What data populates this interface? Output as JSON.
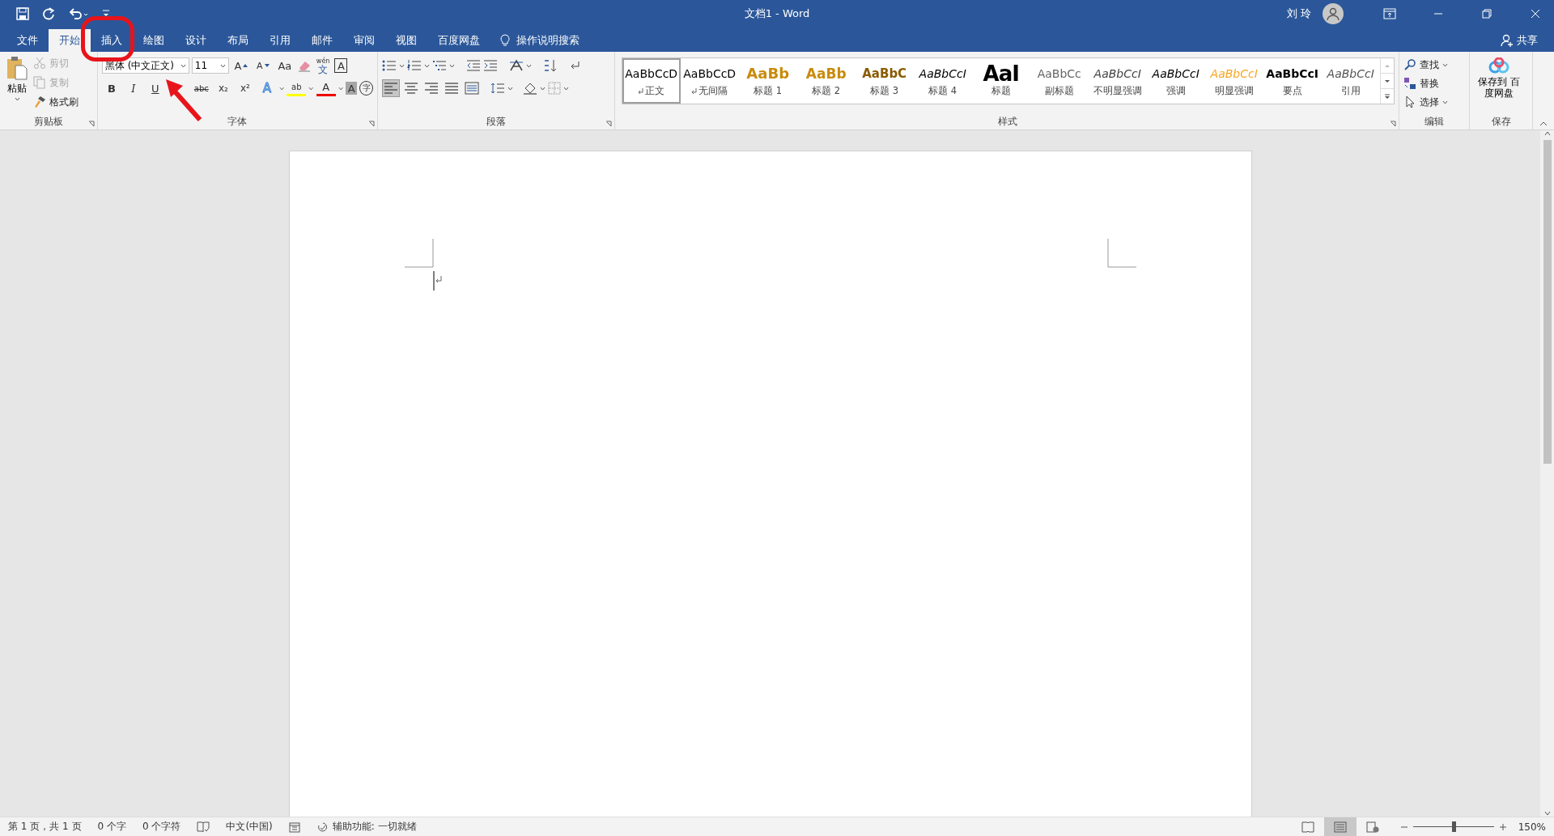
{
  "window": {
    "title": "文档1  -  Word",
    "user": "刘 玲"
  },
  "tabs": [
    {
      "label": "文件",
      "selected": false
    },
    {
      "label": "开始",
      "selected": true
    },
    {
      "label": "插入",
      "selected": false
    },
    {
      "label": "绘图",
      "selected": false
    },
    {
      "label": "设计",
      "selected": false
    },
    {
      "label": "布局",
      "selected": false
    },
    {
      "label": "引用",
      "selected": false
    },
    {
      "label": "邮件",
      "selected": false
    },
    {
      "label": "审阅",
      "selected": false
    },
    {
      "label": "视图",
      "selected": false
    },
    {
      "label": "百度网盘",
      "selected": false
    }
  ],
  "tell_me": "操作说明搜索",
  "share": "共享",
  "clipboard": {
    "paste": "粘贴",
    "items": [
      {
        "label": "剪切",
        "kind": "cut",
        "disabled": true
      },
      {
        "label": "复制",
        "kind": "copy",
        "disabled": true
      },
      {
        "label": "格式刷",
        "kind": "painter",
        "disabled": false
      }
    ],
    "label": "剪贴板"
  },
  "font": {
    "font_name": "黑体 (中文正文)",
    "font_size": "11",
    "tools": [
      {
        "kind": "grow",
        "glyph": "A"
      },
      {
        "kind": "shrink",
        "glyph": "A"
      },
      {
        "kind": "case",
        "glyph": "Aa"
      },
      {
        "kind": "clear"
      },
      {
        "kind": "phonetic",
        "glyph": "文",
        "ruby": "wén"
      },
      {
        "kind": "border",
        "glyph": "A"
      }
    ],
    "formats": [
      {
        "kind": "bold",
        "glyph": "B"
      },
      {
        "kind": "italic",
        "glyph": "I"
      },
      {
        "kind": "underline",
        "glyph": "U"
      },
      {
        "kind": "strike",
        "glyph": "abc"
      },
      {
        "kind": "sub",
        "glyph": "x₂"
      },
      {
        "kind": "sup",
        "glyph": "x²"
      },
      {
        "kind": "effect",
        "glyph": "A"
      },
      {
        "kind": "highlight",
        "glyph": "ab"
      },
      {
        "kind": "color",
        "glyph": "A"
      },
      {
        "kind": "shading",
        "glyph": "A"
      },
      {
        "kind": "enclose",
        "glyph": "字"
      }
    ],
    "label": "字体"
  },
  "paragraph": {
    "alignment": [
      {
        "kind": "left",
        "selected": true
      },
      {
        "kind": "center",
        "selected": false
      },
      {
        "kind": "right",
        "selected": false
      },
      {
        "kind": "justify",
        "selected": false
      },
      {
        "kind": "distributed",
        "selected": false
      }
    ],
    "label": "段落"
  },
  "styles": {
    "items": [
      {
        "sample": "AaBbCcD",
        "name": "正文",
        "kind": "normal",
        "linked": true,
        "selected": true
      },
      {
        "sample": "AaBbCcD",
        "name": "无间隔",
        "kind": "normal",
        "linked": true,
        "selected": false
      },
      {
        "sample": "AaBb",
        "name": "标题 1",
        "kind": "h1",
        "linked": false,
        "selected": false
      },
      {
        "sample": "AaBb",
        "name": "标题 2",
        "kind": "h2",
        "linked": false,
        "selected": false
      },
      {
        "sample": "AaBbC",
        "name": "标题 3",
        "kind": "h3",
        "linked": false,
        "selected": false
      },
      {
        "sample": "AaBbCcI",
        "name": "标题 4",
        "kind": "italic",
        "linked": false,
        "selected": false
      },
      {
        "sample": "AaI",
        "name": "标题",
        "kind": "title",
        "linked": false,
        "selected": false
      },
      {
        "sample": "AaBbCc",
        "name": "副标题",
        "kind": "subtitle",
        "linked": false,
        "selected": false
      },
      {
        "sample": "AaBbCcI",
        "name": "不明显强调",
        "kind": "subtle",
        "linked": false,
        "selected": false
      },
      {
        "sample": "AaBbCcI",
        "name": "强调",
        "kind": "italic",
        "linked": false,
        "selected": false
      },
      {
        "sample": "AaBbCcI",
        "name": "明显强调",
        "kind": "intense",
        "linked": false,
        "selected": false
      },
      {
        "sample": "AaBbCcI",
        "name": "要点",
        "kind": "strong",
        "linked": false,
        "selected": false
      },
      {
        "sample": "AaBbCcI",
        "name": "引用",
        "kind": "quote",
        "linked": false,
        "selected": false
      }
    ],
    "label": "样式"
  },
  "editing": {
    "items": [
      {
        "label": "查找",
        "kind": "find"
      },
      {
        "label": "替换",
        "kind": "replace"
      },
      {
        "label": "选择",
        "kind": "select"
      }
    ],
    "label": "编辑"
  },
  "save": {
    "button": "保存到 百度网盘",
    "label": "保存"
  },
  "status_bar": {
    "page": "第 1 页，共 1 页",
    "words": "0 个字",
    "chars": "0 个字符",
    "language": "中文(中国)",
    "accessibility": "辅助功能: 一切就绪",
    "views": [
      {
        "kind": "read",
        "selected": false
      },
      {
        "kind": "print",
        "selected": true
      },
      {
        "kind": "web",
        "selected": false
      }
    ],
    "zoom": {
      "level": 0.5,
      "reading": "150%"
    }
  }
}
